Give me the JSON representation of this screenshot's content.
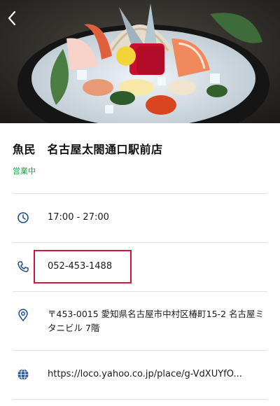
{
  "header": {
    "back_icon": "chevron-left-icon",
    "hero_image": "sashimi-platter-photo"
  },
  "shop": {
    "name": "魚民　名古屋太閤通口駅前店",
    "status": "営業中"
  },
  "details": {
    "hours": {
      "icon": "clock-icon",
      "value": "17:00 - 27:00"
    },
    "phone": {
      "icon": "phone-icon",
      "value": "052-453-1488"
    },
    "address": {
      "icon": "map-pin-icon",
      "value": "〒453-0015 愛知県名古屋市中村区椿町15-2 名古屋ミタニビル 7階"
    },
    "website": {
      "icon": "globe-icon",
      "value": "https://loco.yahoo.co.jp/place/g-VdXUYfO..."
    }
  },
  "colors": {
    "status_green": "#1e9e43",
    "icon_blue": "#1f4f8f",
    "highlight_red": "#d6143e"
  }
}
